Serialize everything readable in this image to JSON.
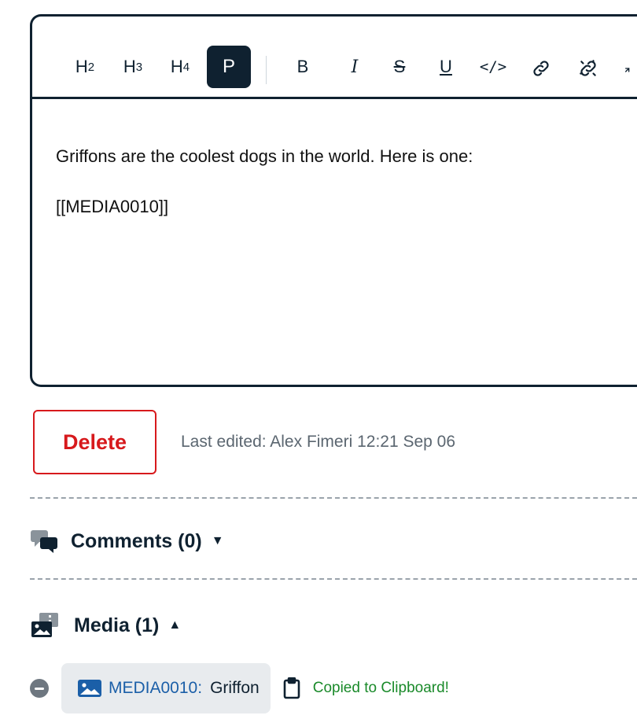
{
  "toolbar": {
    "h2": {
      "main": "H",
      "sub": "2"
    },
    "h3": {
      "main": "H",
      "sub": "3"
    },
    "h4": {
      "main": "H",
      "sub": "4"
    },
    "p": "P",
    "bold": "B",
    "italic": "I",
    "strike": "S",
    "underline": "U",
    "code": "</>",
    "active": "P",
    "icons": [
      "strikethrough-icon",
      "underline-icon",
      "code-icon",
      "link-icon",
      "unlink-icon"
    ]
  },
  "editor": {
    "paragraphs": [
      "Griffons are the coolest dogs in the world. Here is one:",
      "[[MEDIA0010]]"
    ]
  },
  "actions": {
    "delete_label": "Delete",
    "last_edited": "Last edited: Alex Fimeri 12:21 Sep 06"
  },
  "comments": {
    "label": "Comments (0)",
    "expanded": false,
    "icon": "comments-icon"
  },
  "media": {
    "label": "Media (1)",
    "expanded": true,
    "icon": "media-gallery-icon",
    "items": [
      {
        "id": "MEDIA0010:",
        "name": "Griffon",
        "icon": "image-icon"
      }
    ],
    "status": "Copied to Clipboard!"
  },
  "colors": {
    "dark": "#0f2130",
    "delete_red": "#d7191c",
    "link_blue": "#1b5fa8",
    "success_green": "#1a8a2a",
    "chip_bg": "#e8ebee"
  }
}
